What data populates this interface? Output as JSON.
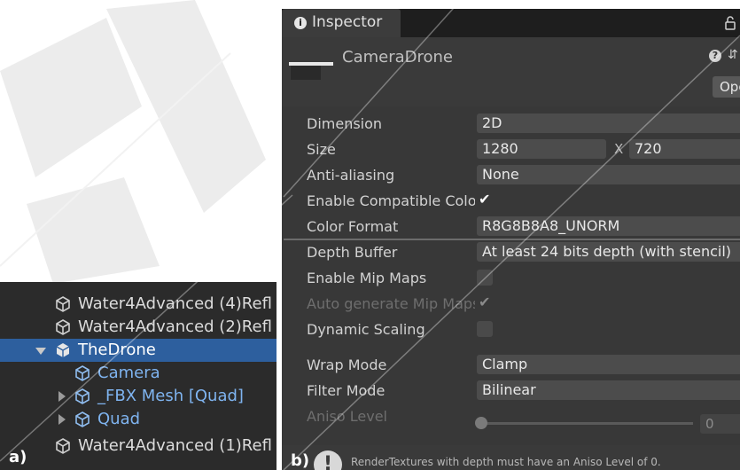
{
  "hierarchy": {
    "panel_label": "a)",
    "items": [
      {
        "label": "Water4Advanced (4)Refl"
      },
      {
        "label": "Water4Advanced (2)Refl"
      },
      {
        "label": "TheDrone"
      },
      {
        "label": "Camera"
      },
      {
        "label": "_FBX Mesh [Quad]"
      },
      {
        "label": "Quad"
      },
      {
        "label": "Water4Advanced (1)Refl"
      }
    ]
  },
  "inspector": {
    "panel_label": "b)",
    "tab_title": "Inspector",
    "object_name": "CameraDrone",
    "open_button": "Open",
    "properties": {
      "dimension": {
        "label": "Dimension",
        "value": "2D"
      },
      "size": {
        "label": "Size",
        "width": "1280",
        "separator": "X",
        "height": "720"
      },
      "anti_aliasing": {
        "label": "Anti-aliasing",
        "value": "None"
      },
      "enable_compatible_color": {
        "label": "Enable Compatible Color",
        "checked": "✔"
      },
      "color_format": {
        "label": "Color Format",
        "value": "R8G8B8A8_UNORM"
      },
      "depth_buffer": {
        "label": "Depth Buffer",
        "value": "At least 24 bits depth (with stencil)"
      },
      "enable_mip_maps": {
        "label": "Enable Mip Maps"
      },
      "auto_generate_mip_maps": {
        "label": "Auto generate Mip Maps",
        "checked": "✔"
      },
      "dynamic_scaling": {
        "label": "Dynamic Scaling"
      },
      "wrap_mode": {
        "label": "Wrap Mode",
        "value": "Clamp"
      },
      "filter_mode": {
        "label": "Filter Mode",
        "value": "Bilinear"
      },
      "aniso_level": {
        "label": "Aniso Level",
        "value": "0",
        "slider_fraction": 0
      }
    },
    "warning": "RenderTextures with depth must have an Aniso Level of 0."
  },
  "colors": {
    "selection": "#2d5f9e",
    "child_text": "#7fb4f0",
    "inspector_bg": "#383838",
    "hierarchy_bg": "#2b2b2b"
  }
}
